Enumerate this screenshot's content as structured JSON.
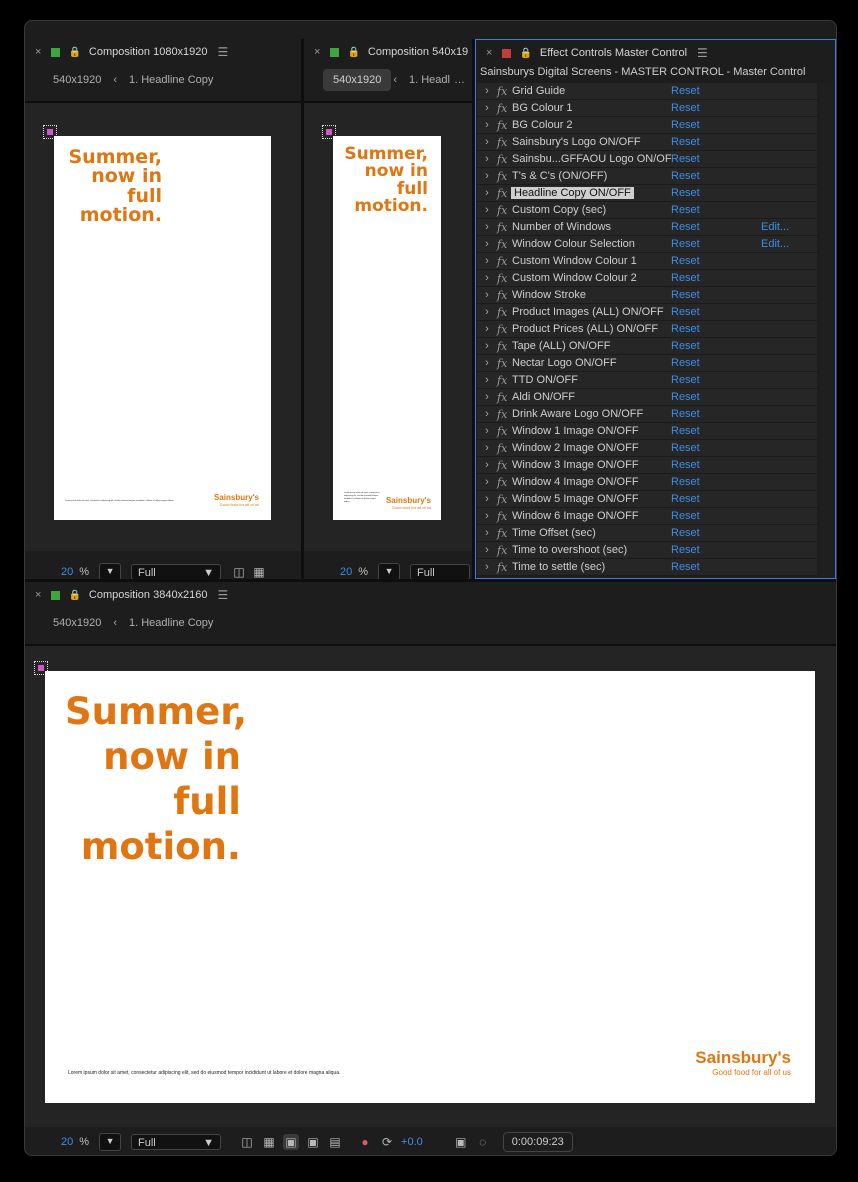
{
  "app": {
    "colors": {
      "accent": "#3d8ee6",
      "brand_orange": "#e07612",
      "active_border": "#3d7fd6"
    }
  },
  "panels": {
    "comp1": {
      "close": "×",
      "label_color": "#3fa63f",
      "title": "Composition 1080x1920",
      "crumbs": [
        "540x1920",
        "1. Headline Copy"
      ]
    },
    "comp2": {
      "close": "×",
      "label_color": "#3fa63f",
      "title": "Composition 540x19",
      "crumbs": [
        "540x1920",
        "1. Headl"
      ],
      "crumb_more": "…"
    },
    "effects": {
      "close": "×",
      "label_color": "#c33c3c",
      "title": "Effect Controls Master Control",
      "layer": "Sainsburys Digital Screens - MASTER CONTROL - Master Control",
      "reset_label": "Reset",
      "rows": [
        {
          "name": "Grid Guide"
        },
        {
          "name": "BG Colour 1"
        },
        {
          "name": "BG Colour 2"
        },
        {
          "name": "Sainsbury's Logo ON/OFF"
        },
        {
          "name": "Sainsbu...GFFAOU Logo ON/OFF"
        },
        {
          "name": "T's & C's (ON/OFF)"
        },
        {
          "name": "Headline Copy ON/OFF",
          "highlight": true
        },
        {
          "name": "Custom Copy (sec)"
        },
        {
          "name": "Number of Windows",
          "edit": "Edit..."
        },
        {
          "name": "Window Colour Selection",
          "edit": "Edit..."
        },
        {
          "name": "Custom Window Colour 1"
        },
        {
          "name": "Custom Window Colour 2"
        },
        {
          "name": "Window Stroke"
        },
        {
          "name": "Product Images (ALL) ON/OFF"
        },
        {
          "name": "Product Prices (ALL) ON/OFF"
        },
        {
          "name": "Tape (ALL) ON/OFF"
        },
        {
          "name": "Nectar Logo ON/OFF"
        },
        {
          "name": "TTD ON/OFF"
        },
        {
          "name": "Aldi ON/OFF"
        },
        {
          "name": "Drink Aware Logo ON/OFF"
        },
        {
          "name": "Window 1 Image ON/OFF"
        },
        {
          "name": "Window 2 Image ON/OFF"
        },
        {
          "name": "Window 3 Image ON/OFF"
        },
        {
          "name": "Window 4 Image ON/OFF"
        },
        {
          "name": "Window 5 Image ON/OFF"
        },
        {
          "name": "Window 6 Image ON/OFF"
        },
        {
          "name": "Time Offset (sec)"
        },
        {
          "name": "Time to overshoot (sec)"
        },
        {
          "name": "Time to settle (sec)"
        }
      ]
    },
    "comp3": {
      "close": "×",
      "label_color": "#3fa63f",
      "title": "Composition 3840x2160",
      "crumbs": [
        "540x1920",
        "1. Headline Copy"
      ]
    }
  },
  "artwork": {
    "headline": [
      "Summer,",
      "now in",
      "full",
      "motion."
    ],
    "disclaimer": "Lorem ipsum dolor sit amet, consectetur adipiscing elit, sed do eiusmod tempor incididunt ut labore et dolore magna aliqua.",
    "logo": "Sainsbury's",
    "tagline": "Good food for all of us"
  },
  "viewer_footer": {
    "zoom": "20",
    "pct": "%",
    "resolution": "Full",
    "exposure": "+0.0",
    "timecode": "0:00:09:23"
  }
}
